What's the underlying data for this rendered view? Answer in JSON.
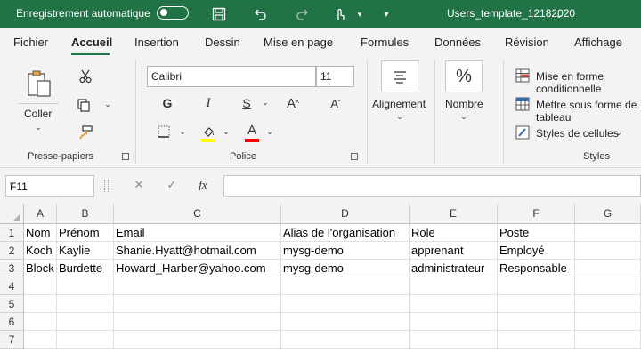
{
  "titlebar": {
    "autosave_label": "Enregistrement automatique",
    "filename": "Users_template_12182020",
    "color": "#217346"
  },
  "menu": {
    "tabs": [
      "Fichier",
      "Accueil",
      "Insertion",
      "Dessin",
      "Mise en page",
      "Formules",
      "Données",
      "Révision",
      "Affichage"
    ],
    "active": "Accueil"
  },
  "ribbon": {
    "clipboard": {
      "paste_label": "Coller",
      "group_label": "Presse-papiers"
    },
    "font": {
      "name": "Calibri",
      "size": "11",
      "bold": "G",
      "italic": "I",
      "underline": "S",
      "grow": "A",
      "shrink": "A",
      "color_letter": "A",
      "group_label": "Police",
      "highlight_color": "#ffff00",
      "font_color": "#ff0000"
    },
    "alignment": {
      "label": "Alignement"
    },
    "number": {
      "label": "Nombre",
      "symbol": "%"
    },
    "styles": {
      "conditional": "Mise en forme conditionnelle",
      "table": "Mettre sous forme de tableau",
      "cell_styles": "Styles de cellules",
      "group_label": "Styles"
    }
  },
  "formula_bar": {
    "name_box": "F11",
    "fx": "fx",
    "content": ""
  },
  "sheet": {
    "columns": [
      "A",
      "B",
      "C",
      "D",
      "E",
      "F",
      "G"
    ],
    "row_numbers": [
      "1",
      "2",
      "3",
      "4",
      "5",
      "6",
      "7"
    ],
    "rows": [
      [
        "Nom",
        "Prénom",
        "Email",
        "Alias de l'organisation",
        "Role",
        "Poste",
        ""
      ],
      [
        "Koch",
        "Kaylie",
        "Shanie.Hyatt@hotmail.com",
        "mysg-demo",
        "apprenant",
        "Employé",
        ""
      ],
      [
        "Block",
        "Burdette",
        "Howard_Harber@yahoo.com",
        "mysg-demo",
        "administrateur",
        "Responsable",
        ""
      ],
      [
        "",
        "",
        "",
        "",
        "",
        "",
        ""
      ],
      [
        "",
        "",
        "",
        "",
        "",
        "",
        ""
      ],
      [
        "",
        "",
        "",
        "",
        "",
        "",
        ""
      ],
      [
        "",
        "",
        "",
        "",
        "",
        "",
        ""
      ]
    ]
  }
}
